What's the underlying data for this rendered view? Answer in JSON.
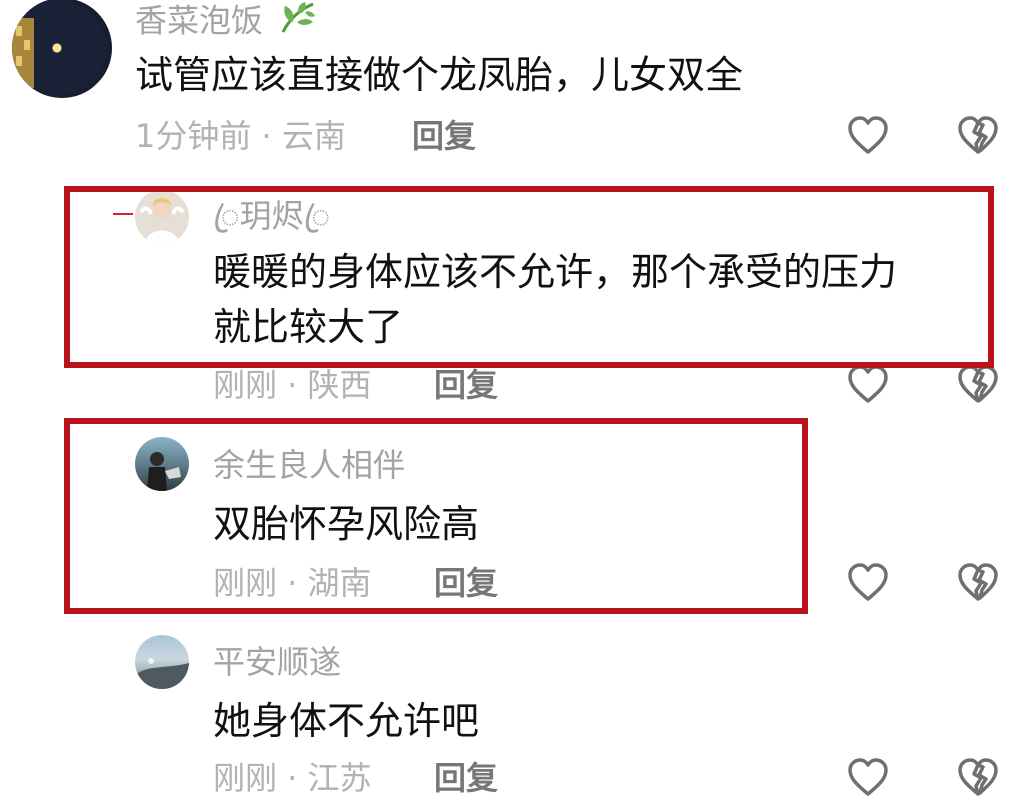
{
  "comments": [
    {
      "username": "香菜泡饭",
      "text": "试管应该直接做个龙凤胎，儿女双全",
      "time_location": "1分钟前 · 云南",
      "reply_label": "回复"
    },
    {
      "username": "ꦿ玥烬ꦿ",
      "text_line1": "暖暖的身体应该不允许，那个承受的压力",
      "text_line2": "就比较大了",
      "time_location": "刚刚 · 陕西",
      "reply_label": "回复"
    },
    {
      "username": "余生良人相伴",
      "text": "双胎怀孕风险高",
      "time_location": "刚刚 · 湖南",
      "reply_label": "回复"
    },
    {
      "username": "平安顺遂",
      "text": "她身体不允许吧",
      "time_location": "刚刚 · 江苏",
      "reply_label": "回复"
    }
  ],
  "colors": {
    "highlight_border": "#b8121a",
    "username": "#a3a3a3",
    "meta": "#b2b2b2"
  },
  "icons": [
    "leaf-icon",
    "heart-icon",
    "broken-heart-icon"
  ]
}
